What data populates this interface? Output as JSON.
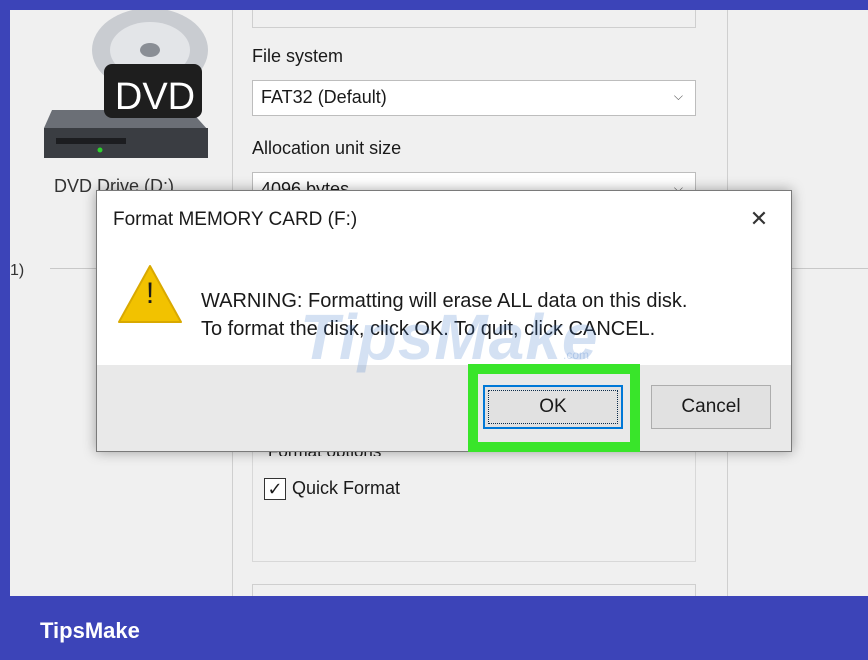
{
  "explorer": {
    "drive_label": "DVD Drive (D:)",
    "drive_badge": "DVD",
    "partial_text": "1)"
  },
  "format_panel": {
    "file_system_label": "File system",
    "file_system_value": "FAT32 (Default)",
    "alloc_label": "Allocation unit size",
    "alloc_value": "4096 bytes",
    "options_legend": "Format options",
    "quick_format_label": "Quick Format",
    "quick_format_checked": "✓"
  },
  "dialog": {
    "title": "Format MEMORY CARD (F:)",
    "close_glyph": "✕",
    "message_line1": "WARNING: Formatting will erase ALL data on this disk.",
    "message_line2": "To format the disk, click OK. To quit, click CANCEL.",
    "ok_label": "OK",
    "cancel_label": "Cancel",
    "warning_glyph": "!"
  },
  "watermark": {
    "text": "TipsMake",
    "suffix": ".com"
  },
  "brand": {
    "name": "TipsMake"
  },
  "colors": {
    "frame": "#3c44b8",
    "highlight": "#39e52a",
    "focus": "#0078d7",
    "warning": "#f2c200"
  },
  "icons": [
    "dvd-drive-icon",
    "warning-icon",
    "close-icon",
    "chevron-down-icon",
    "checkbox-check-icon"
  ]
}
